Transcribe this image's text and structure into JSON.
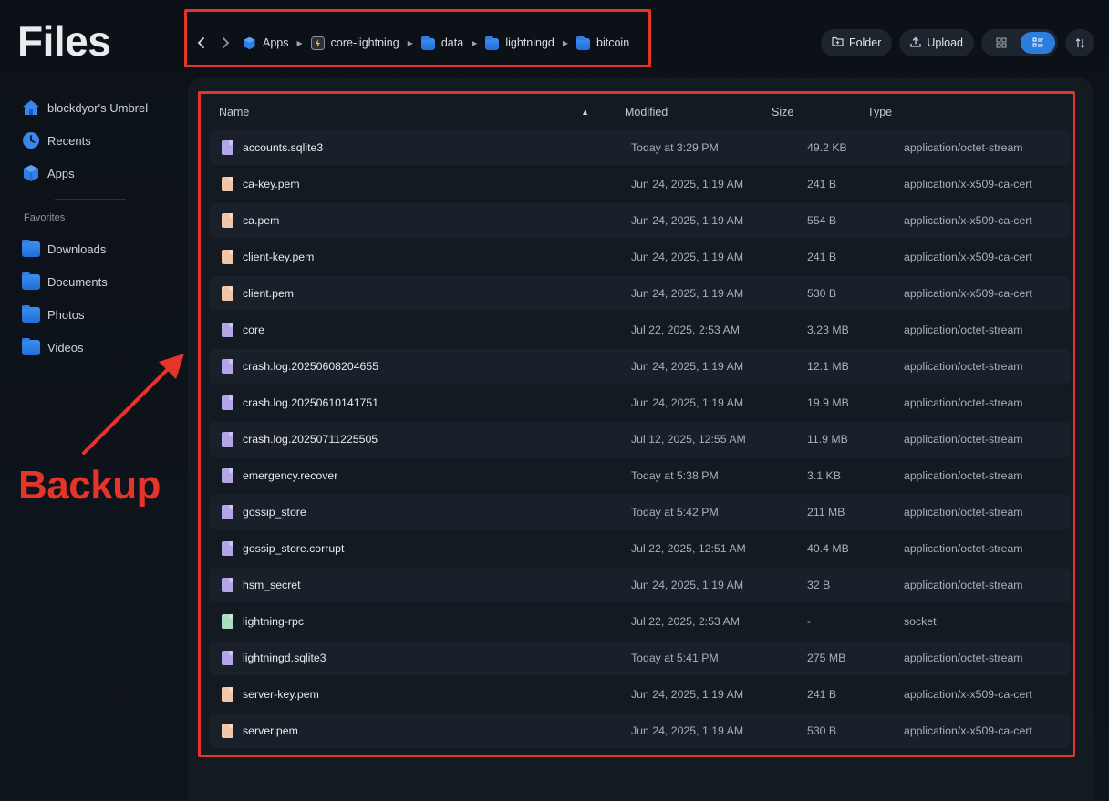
{
  "app": {
    "title": "Files"
  },
  "sidebar": {
    "top_items": [
      {
        "label": "blockdyor's Umbrel",
        "icon": "home-icon"
      },
      {
        "label": "Recents",
        "icon": "clock-icon"
      },
      {
        "label": "Apps",
        "icon": "cube-icon"
      }
    ],
    "favorites_heading": "Favorites",
    "favorites": [
      {
        "label": "Downloads",
        "icon": "download-folder-icon"
      },
      {
        "label": "Documents",
        "icon": "document-folder-icon"
      },
      {
        "label": "Photos",
        "icon": "photo-folder-icon"
      },
      {
        "label": "Videos",
        "icon": "video-folder-icon"
      }
    ]
  },
  "breadcrumb": {
    "items": [
      "Apps",
      "core-lightning",
      "data",
      "lightningd",
      "bitcoin"
    ]
  },
  "toolbar": {
    "folder_label": "Folder",
    "upload_label": "Upload",
    "view_mode": "list"
  },
  "table": {
    "headers": {
      "name": "Name",
      "modified": "Modified",
      "size": "Size",
      "type": "Type"
    },
    "sort": {
      "column": "name",
      "direction": "ascending"
    },
    "rows": [
      {
        "name": "accounts.sqlite3",
        "modified": "Today at 3:29 PM",
        "size": "49.2 KB",
        "type": "application/octet-stream",
        "icon_color": "#b3a5e8"
      },
      {
        "name": "ca-key.pem",
        "modified": "Jun 24, 2025, 1:19 AM",
        "size": "241 B",
        "type": "application/x-x509-ca-cert",
        "icon_color": "#efc6a8"
      },
      {
        "name": "ca.pem",
        "modified": "Jun 24, 2025, 1:19 AM",
        "size": "554 B",
        "type": "application/x-x509-ca-cert",
        "icon_color": "#efc6a8"
      },
      {
        "name": "client-key.pem",
        "modified": "Jun 24, 2025, 1:19 AM",
        "size": "241 B",
        "type": "application/x-x509-ca-cert",
        "icon_color": "#efc6a8"
      },
      {
        "name": "client.pem",
        "modified": "Jun 24, 2025, 1:19 AM",
        "size": "530 B",
        "type": "application/x-x509-ca-cert",
        "icon_color": "#efc6a8"
      },
      {
        "name": "core",
        "modified": "Jul 22, 2025, 2:53 AM",
        "size": "3.23 MB",
        "type": "application/octet-stream",
        "icon_color": "#b3a5e8"
      },
      {
        "name": "crash.log.20250608204655",
        "modified": "Jun 24, 2025, 1:19 AM",
        "size": "12.1 MB",
        "type": "application/octet-stream",
        "icon_color": "#b3a5e8"
      },
      {
        "name": "crash.log.20250610141751",
        "modified": "Jun 24, 2025, 1:19 AM",
        "size": "19.9 MB",
        "type": "application/octet-stream",
        "icon_color": "#b3a5e8"
      },
      {
        "name": "crash.log.20250711225505",
        "modified": "Jul 12, 2025, 12:55 AM",
        "size": "11.9 MB",
        "type": "application/octet-stream",
        "icon_color": "#b3a5e8"
      },
      {
        "name": "emergency.recover",
        "modified": "Today at 5:38 PM",
        "size": "3.1 KB",
        "type": "application/octet-stream",
        "icon_color": "#b3a5e8"
      },
      {
        "name": "gossip_store",
        "modified": "Today at 5:42 PM",
        "size": "211 MB",
        "type": "application/octet-stream",
        "icon_color": "#b3a5e8"
      },
      {
        "name": "gossip_store.corrupt",
        "modified": "Jul 22, 2025, 12:51 AM",
        "size": "40.4 MB",
        "type": "application/octet-stream",
        "icon_color": "#b3a5e8"
      },
      {
        "name": "hsm_secret",
        "modified": "Jun 24, 2025, 1:19 AM",
        "size": "32 B",
        "type": "application/octet-stream",
        "icon_color": "#b3a5e8"
      },
      {
        "name": "lightning-rpc",
        "modified": "Jul 22, 2025, 2:53 AM",
        "size": "-",
        "type": "socket",
        "icon_color": "#a6dfbe"
      },
      {
        "name": "lightningd.sqlite3",
        "modified": "Today at 5:41 PM",
        "size": "275 MB",
        "type": "application/octet-stream",
        "icon_color": "#b3a5e8"
      },
      {
        "name": "server-key.pem",
        "modified": "Jun 24, 2025, 1:19 AM",
        "size": "241 B",
        "type": "application/x-x509-ca-cert",
        "icon_color": "#efc6a8"
      },
      {
        "name": "server.pem",
        "modified": "Jun 24, 2025, 1:19 AM",
        "size": "530 B",
        "type": "application/x-x509-ca-cert",
        "icon_color": "#efc6a8"
      }
    ]
  },
  "annotation": {
    "label": "Backup",
    "color": "#e5352a"
  },
  "colors": {
    "accent": "#2c7de0",
    "folder": "#2f7fe5"
  }
}
